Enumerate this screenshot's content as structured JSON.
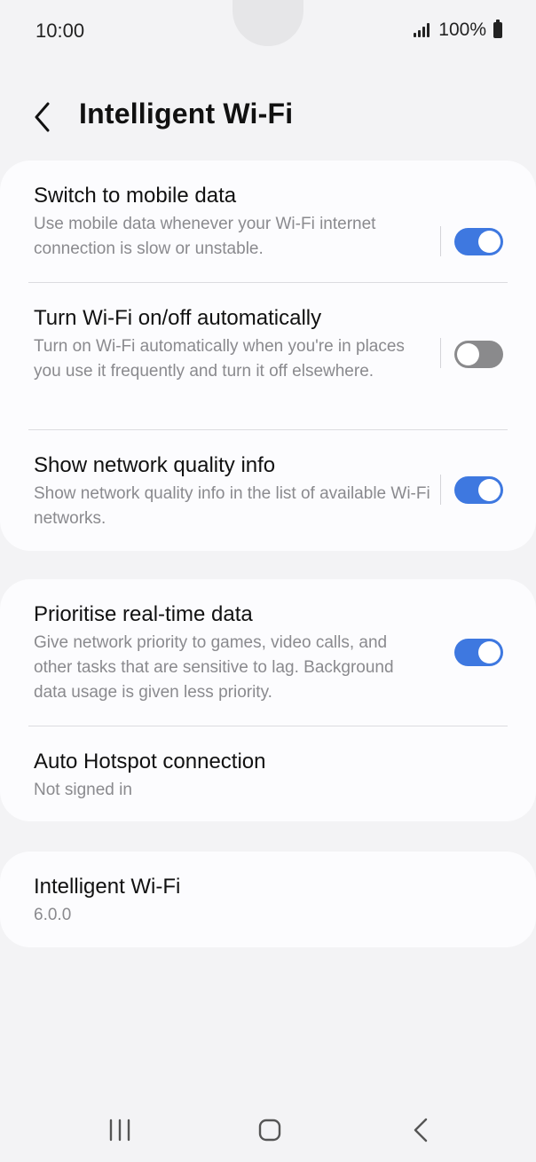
{
  "status_bar": {
    "time": "10:00",
    "battery": "100%",
    "signal_icon": "signal-bars-icon",
    "battery_icon": "battery-full-icon"
  },
  "header": {
    "back_icon": "chevron-left-icon",
    "title": "Intelligent Wi-Fi"
  },
  "settings_group_1": [
    {
      "title": "Switch to mobile data",
      "subtitle": "Use mobile data whenever your Wi-Fi internet connection is slow or unstable.",
      "toggle_on": true
    },
    {
      "title": "Turn Wi-Fi on/off automatically",
      "subtitle": "Turn on Wi-Fi automatically when you're in places you use it frequently and turn it off elsewhere.",
      "toggle_on": false
    },
    {
      "title": "Show network quality info",
      "subtitle": "Show network quality info in the list of available Wi-Fi networks.",
      "toggle_on": true
    }
  ],
  "settings_group_2": [
    {
      "title": "Prioritise real-time data",
      "subtitle": "Give network priority to games, video calls, and other tasks that are sensitive to lag. Background data usage is given less priority.",
      "toggle_on": true
    },
    {
      "title": "Auto Hotspot connection",
      "subtitle": "Not signed in"
    }
  ],
  "about": {
    "title": "Intelligent Wi-Fi",
    "version": "6.0.0"
  },
  "nav_bar": {
    "recents_icon": "recent-apps-icon",
    "home_icon": "home-icon",
    "back_icon": "back-icon"
  },
  "colors": {
    "accent": "#3e78e0",
    "toggle_off": "#8a8a8c",
    "background": "#f3f3f5",
    "card": "#fcfcfe"
  }
}
